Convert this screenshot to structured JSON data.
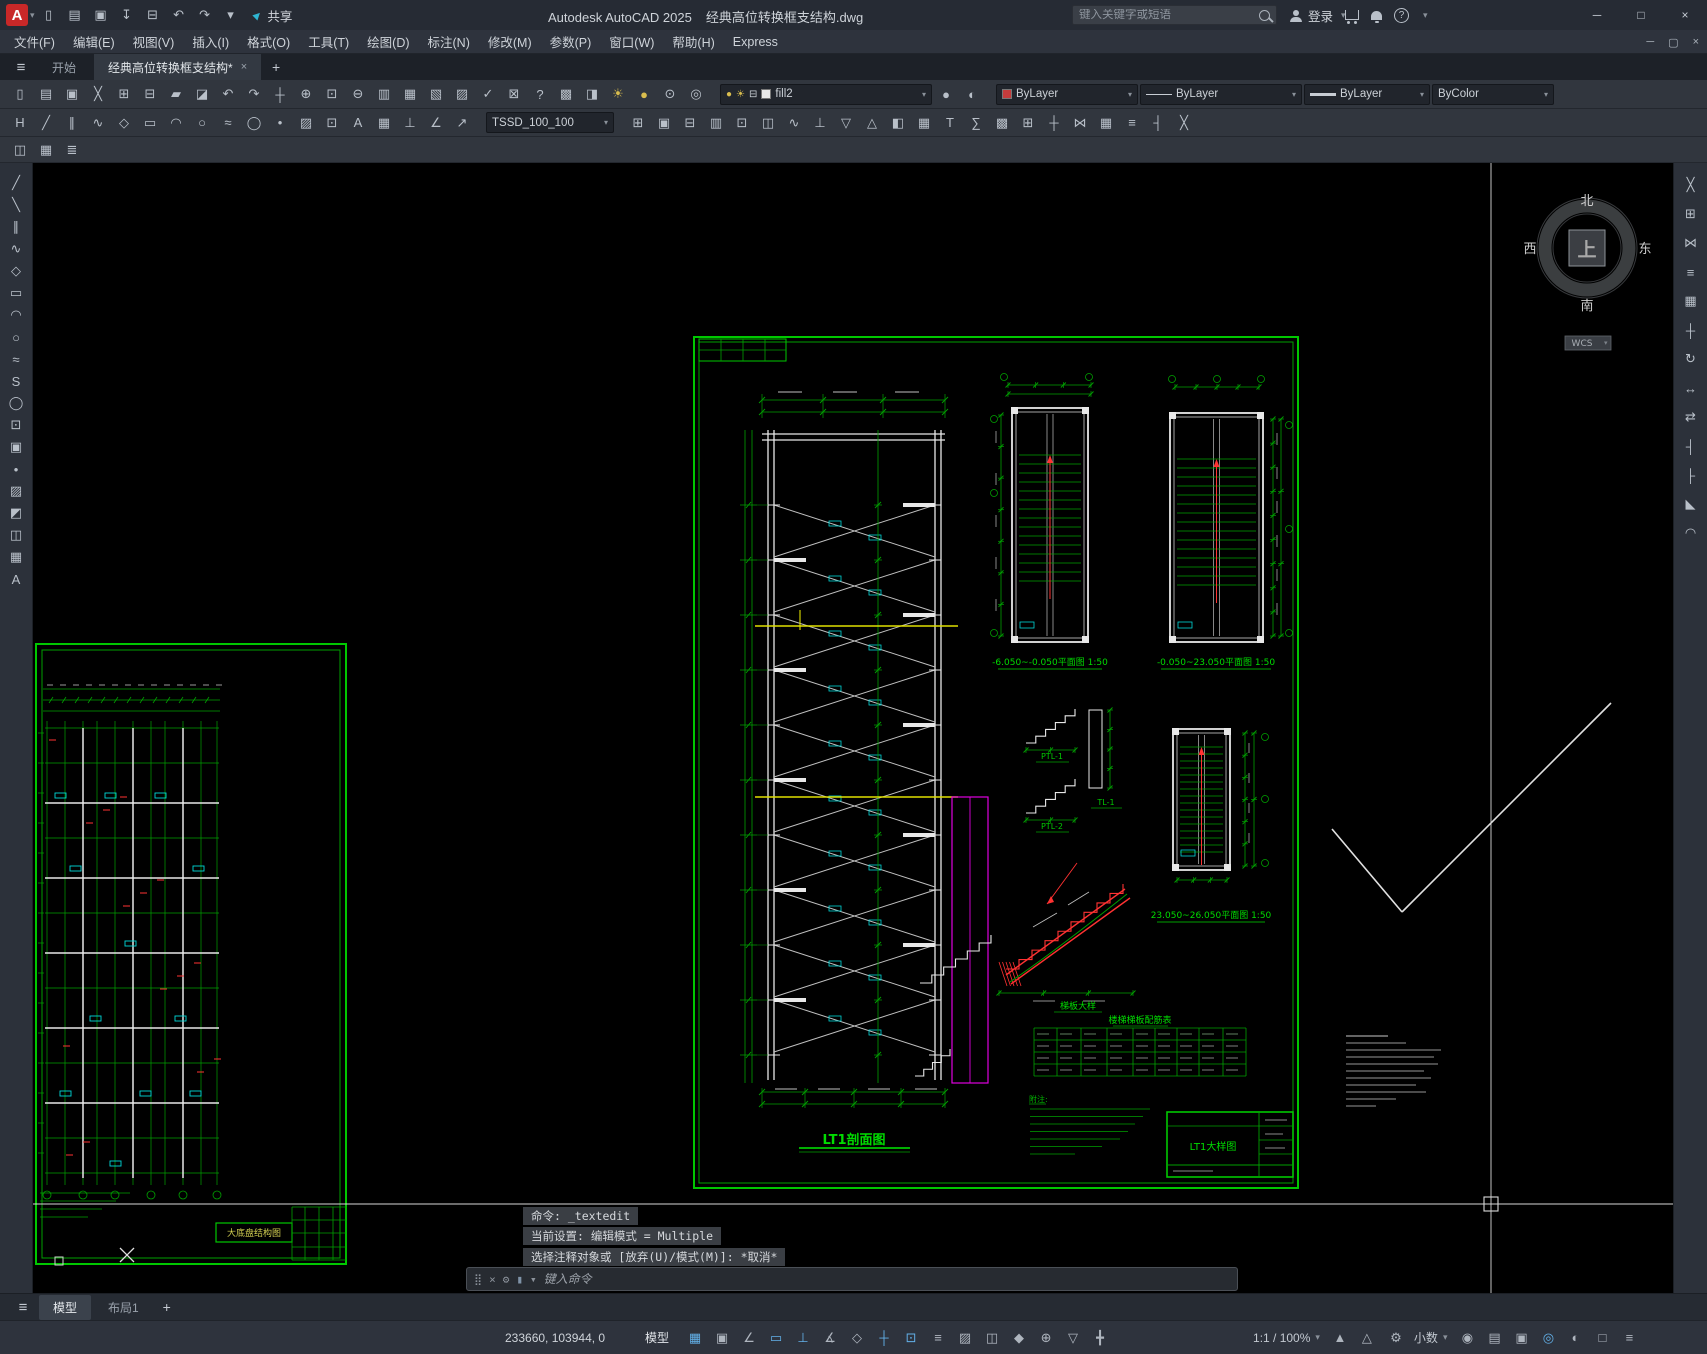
{
  "colors": {
    "accent": "#62b0e8",
    "cad_green": "#00c800",
    "cad_cyan": "#00d8d8",
    "cad_yellow": "#e0e000",
    "cad_magenta": "#e000e0",
    "cad_red": "#ff3232",
    "canvas_bg": "#000000"
  },
  "app": {
    "logo_letter": "A",
    "title": "Autodesk AutoCAD 2025",
    "doc_name": "经典高位转换框支结构.dwg",
    "share_label": "共享",
    "search_placeholder": "键入关键字或短语",
    "signin_label": "登录"
  },
  "menus": [
    "文件(F)",
    "编辑(E)",
    "视图(V)",
    "插入(I)",
    "格式(O)",
    "工具(T)",
    "绘图(D)",
    "标注(N)",
    "修改(M)",
    "参数(P)",
    "窗口(W)",
    "帮助(H)",
    "Express"
  ],
  "file_tabs": {
    "start": "开始",
    "document": "经典高位转换框支结构*"
  },
  "combos": {
    "layer": "fill2",
    "color": "ByLayer",
    "linetype": "ByLayer",
    "lineweight": "ByLayer",
    "plot_style": "ByColor",
    "tssd": "TSSD_100_100"
  },
  "toolbars": {
    "qat": [
      [
        "qnew",
        "▯"
      ],
      [
        "qopen",
        "▤"
      ],
      [
        "qsave",
        "▣"
      ],
      [
        "save-as",
        "↧"
      ],
      [
        "plot",
        "⊟"
      ],
      [
        "undo",
        "↶"
      ],
      [
        "redo",
        "↷"
      ],
      [
        "qat-more",
        "▾"
      ]
    ],
    "row1": [
      [
        "new-file",
        "▯"
      ],
      [
        "open-file",
        "▤"
      ],
      [
        "save",
        "▣"
      ],
      [
        "cut",
        "╳"
      ],
      [
        "copy",
        "⊞"
      ],
      [
        "paste",
        "⊟"
      ],
      [
        "match-properties",
        "▰"
      ],
      [
        "block-editor",
        "◪"
      ],
      [
        "undo",
        "↶"
      ],
      [
        "redo",
        "↷"
      ],
      [
        "pan",
        "┼"
      ],
      [
        "zoom-realtime",
        "⊕"
      ],
      [
        "zoom-window",
        "⊡"
      ],
      [
        "zoom-previous",
        "⊖"
      ],
      [
        "properties",
        "▥"
      ],
      [
        "designcenter",
        "▦"
      ],
      [
        "tool-palettes",
        "▧"
      ],
      [
        "sheet-set-manager",
        "▨"
      ],
      [
        "markup-import",
        "✓"
      ],
      [
        "quickcalc",
        "⊠"
      ],
      [
        "help",
        "?"
      ],
      [
        "layer-properties",
        "▩"
      ],
      [
        "layer-walk",
        "◨"
      ],
      [
        "layer-freeze",
        "☀",
        "#d9bd4e"
      ],
      [
        "layer-off",
        "●",
        "#d9bd4e"
      ],
      [
        "layer-lock",
        "⊙"
      ],
      [
        "layer-states",
        "◎"
      ]
    ],
    "row1b": [
      [
        "make-object-layer-current",
        "●"
      ],
      [
        "layer-previous",
        "◐"
      ]
    ],
    "row2a": [
      [
        "grid-axis",
        "H"
      ],
      [
        "draw-line",
        "╱"
      ],
      [
        "draw-mline",
        "∥"
      ],
      [
        "draw-pline",
        "∿"
      ],
      [
        "draw-polygon",
        "◇"
      ],
      [
        "draw-rectangle",
        "▭"
      ],
      [
        "draw-arc",
        "◠"
      ],
      [
        "draw-circle",
        "○"
      ],
      [
        "draw-revcloud",
        "≈"
      ],
      [
        "draw-ellipse",
        "◯"
      ],
      [
        "draw-point",
        "•"
      ],
      [
        "draw-hatch",
        "▨"
      ],
      [
        "block-insert",
        "⊡"
      ],
      [
        "draw-text",
        "A"
      ],
      [
        "draw-table",
        "▦"
      ],
      [
        "dim-linear",
        "⊥"
      ],
      [
        "dim-angular",
        "∠"
      ],
      [
        "leader",
        "↗"
      ]
    ],
    "row2b": [
      [
        "tssd-axis-grid",
        "⊞"
      ],
      [
        "tssd-column",
        "▣"
      ],
      [
        "tssd-beam",
        "⊟"
      ],
      [
        "tssd-wall",
        "▥"
      ],
      [
        "tssd-slab",
        "⊡"
      ],
      [
        "tssd-stair",
        "◫"
      ],
      [
        "tssd-rebar",
        "∿"
      ],
      [
        "tssd-dimension",
        "⊥"
      ],
      [
        "tssd-elevation",
        "▽"
      ],
      [
        "tssd-section",
        "△"
      ],
      [
        "tssd-detail",
        "◧"
      ],
      [
        "tssd-table",
        "▦"
      ],
      [
        "tssd-text",
        "T"
      ],
      [
        "tssd-calc",
        "∑"
      ],
      [
        "tssd-layer",
        "▩"
      ],
      [
        "tssd-copy",
        "⊞"
      ],
      [
        "tssd-move",
        "┼"
      ],
      [
        "tssd-mirror",
        "⋈"
      ],
      [
        "tssd-array",
        "▦"
      ],
      [
        "tssd-offset",
        "≡"
      ],
      [
        "tssd-trim",
        "┤"
      ],
      [
        "tssd-purge",
        "╳"
      ]
    ],
    "row3": [
      [
        "tssd-text-edit",
        "◫"
      ],
      [
        "tssd-attribute",
        "▦"
      ],
      [
        "tssd-format-brush",
        "≣"
      ]
    ],
    "left": [
      [
        "line",
        "╱"
      ],
      [
        "construction-line",
        "╲"
      ],
      [
        "multiline",
        "∥"
      ],
      [
        "polyline",
        "∿"
      ],
      [
        "polygon",
        "◇"
      ],
      [
        "rectangle",
        "▭"
      ],
      [
        "arc",
        "◠"
      ],
      [
        "circle",
        "○"
      ],
      [
        "revision-cloud",
        "≈"
      ],
      [
        "spline",
        "S"
      ],
      [
        "ellipse",
        "◯"
      ],
      [
        "insert-block",
        "⊡"
      ],
      [
        "make-block",
        "▣"
      ],
      [
        "point",
        "•"
      ],
      [
        "hatch",
        "▨"
      ],
      [
        "gradient",
        "◩"
      ],
      [
        "region",
        "◫"
      ],
      [
        "table",
        "▦"
      ],
      [
        "mtext",
        "A"
      ]
    ],
    "right": [
      [
        "erase",
        "╳"
      ],
      [
        "copy",
        "⊞"
      ],
      [
        "mirror",
        "⋈"
      ],
      [
        "offset",
        "≡"
      ],
      [
        "array",
        "▦"
      ],
      [
        "move",
        "┼"
      ],
      [
        "rotate",
        "↻"
      ],
      [
        "scale",
        "↔"
      ],
      [
        "stretch",
        "⇄"
      ],
      [
        "trim",
        "┤"
      ],
      [
        "extend",
        "├"
      ],
      [
        "chamfer",
        "◣"
      ],
      [
        "fillet",
        "◠"
      ]
    ],
    "status1": [
      [
        "grid-display",
        "▦",
        true
      ],
      [
        "snap-mode",
        "▣",
        false
      ],
      [
        "infer-constraints",
        "∠",
        false
      ],
      [
        "dynamic-input",
        "▭",
        true
      ],
      [
        "ortho-mode",
        "⊥",
        true
      ],
      [
        "polar-tracking",
        "∡",
        false
      ],
      [
        "isometric-drafting",
        "◇",
        false
      ],
      [
        "object-snap-tracking",
        "┼",
        true
      ],
      [
        "object-snap",
        "⊡",
        true
      ],
      [
        "lineweight-display",
        "≡",
        false
      ],
      [
        "transparency",
        "▨",
        false
      ],
      [
        "selection-cycling",
        "◫",
        false
      ],
      [
        "3d-object-snap",
        "◆",
        false
      ],
      [
        "dynamic-ucs",
        "⊕",
        false
      ],
      [
        "selection-filtering",
        "▽",
        false
      ],
      [
        "gizmo",
        "╋",
        false
      ]
    ],
    "status2": [
      [
        "annotation-visibility",
        "▲",
        false
      ],
      [
        "annotation-autoscale",
        "△",
        false
      ]
    ],
    "status3": [
      [
        "annotation-monitor",
        "◉",
        false
      ],
      [
        "quick-properties",
        "▤",
        false
      ],
      [
        "lock-ui",
        "▣",
        false
      ],
      [
        "isolate-objects",
        "◎",
        true
      ],
      [
        "graphics-performance",
        "◐",
        false
      ],
      [
        "clean-screen",
        "□",
        false
      ],
      [
        "customize",
        "≡",
        false
      ]
    ]
  },
  "drawing": {
    "section_label": "LT1剖面图",
    "plan1_label": "-6.050~-0.050平面图 1:50",
    "plan2_label": "-0.050~23.050平面图 1:50",
    "plan3_label": "23.050~26.050平面图 1:50",
    "stair_detail_label": "梯板大样",
    "table_title": "楼梯梯板配筋表",
    "titleblock_label": "LT1大样图",
    "left_drawing_label": "大底盘结构图",
    "notes_title": "附注:",
    "detail1_label": "PTL-1",
    "detail2_label": "PTL-2",
    "detail3_label": "TL-1",
    "compass": {
      "n": "北",
      "s": "南",
      "w": "西",
      "e": "东",
      "top": "上",
      "wcs": "WCS"
    }
  },
  "commandline": {
    "line1": "命令: _textedit",
    "line2": "当前设置: 编辑模式 = Multiple",
    "line3": "选择注释对象或 [放弃(U)/模式(M)]: *取消*",
    "placeholder": "键入命令"
  },
  "layout_tabs": {
    "model": "模型",
    "layout1": "布局1",
    "add": "+"
  },
  "statusbar": {
    "coords": "233660, 103944, 0",
    "space_label": "模型",
    "scale": "1:1 / 100%",
    "units": "小数"
  }
}
